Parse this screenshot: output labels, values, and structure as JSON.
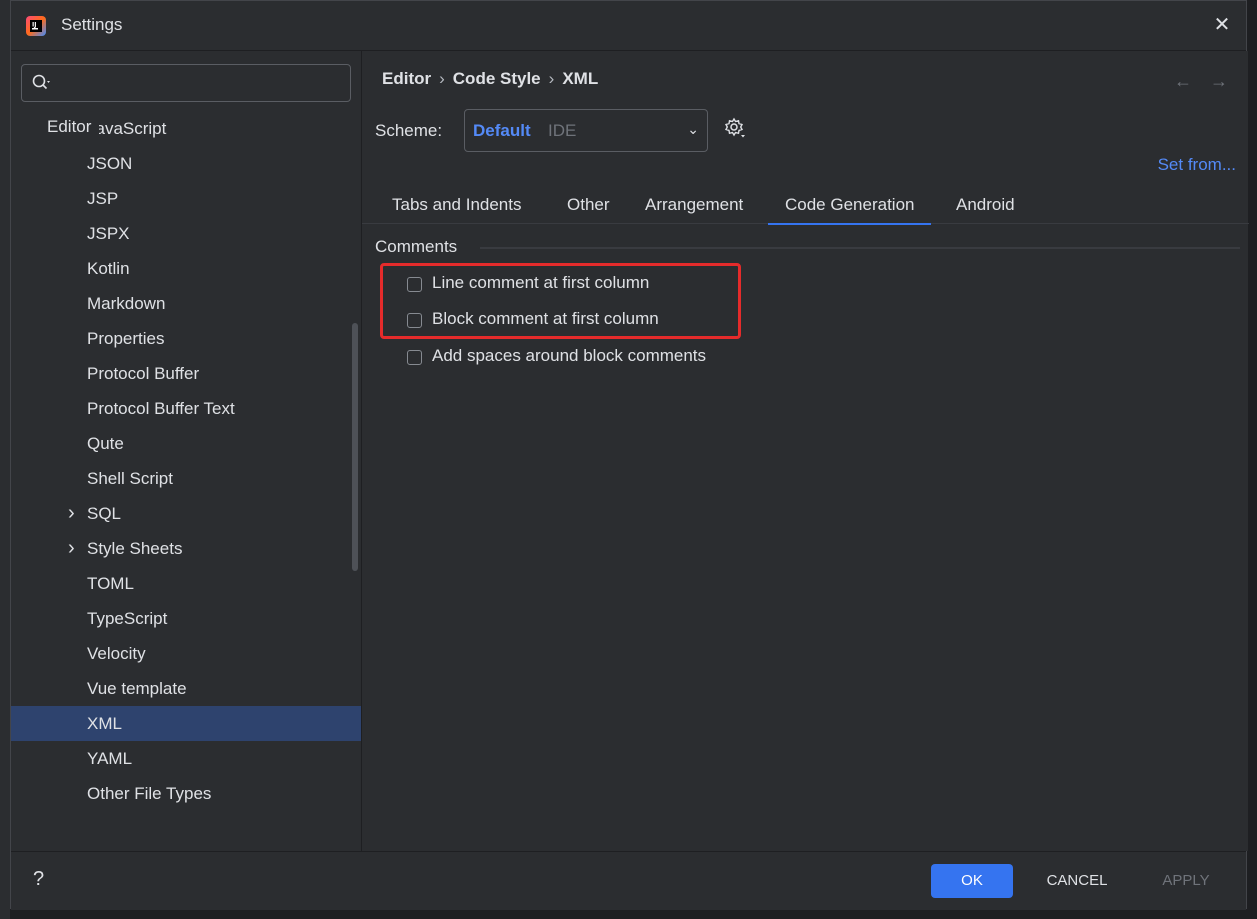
{
  "window": {
    "title": "Settings"
  },
  "sidebar": {
    "search": {
      "value": ""
    },
    "header": "Editor",
    "items": [
      {
        "label": "JavaScript",
        "expandable": false
      },
      {
        "label": "JSON",
        "expandable": false
      },
      {
        "label": "JSP",
        "expandable": false
      },
      {
        "label": "JSPX",
        "expandable": false
      },
      {
        "label": "Kotlin",
        "expandable": false
      },
      {
        "label": "Markdown",
        "expandable": false
      },
      {
        "label": "Properties",
        "expandable": false
      },
      {
        "label": "Protocol Buffer",
        "expandable": false
      },
      {
        "label": "Protocol Buffer Text",
        "expandable": false
      },
      {
        "label": "Qute",
        "expandable": false
      },
      {
        "label": "Shell Script",
        "expandable": false
      },
      {
        "label": "SQL",
        "expandable": true
      },
      {
        "label": "Style Sheets",
        "expandable": true
      },
      {
        "label": "TOML",
        "expandable": false
      },
      {
        "label": "TypeScript",
        "expandable": false
      },
      {
        "label": "Velocity",
        "expandable": false
      },
      {
        "label": "Vue template",
        "expandable": false
      },
      {
        "label": "XML",
        "expandable": false,
        "selected": true
      },
      {
        "label": "YAML",
        "expandable": false
      },
      {
        "label": "Other File Types",
        "expandable": false
      }
    ]
  },
  "breadcrumb": [
    "Editor",
    "Code Style",
    "XML"
  ],
  "scheme": {
    "label": "Scheme:",
    "value": "Default",
    "scope": "IDE"
  },
  "set_from": "Set from...",
  "tabs": [
    {
      "label": "Tabs and Indents"
    },
    {
      "label": "Other"
    },
    {
      "label": "Arrangement"
    },
    {
      "label": "Code Generation",
      "active": true
    },
    {
      "label": "Android"
    }
  ],
  "comments": {
    "title": "Comments",
    "options": [
      {
        "label": "Line comment at first column",
        "checked": false
      },
      {
        "label": "Block comment at first column",
        "checked": false
      },
      {
        "label": "Add spaces around block comments",
        "checked": false
      }
    ]
  },
  "footer": {
    "help": "?",
    "ok": "OK",
    "cancel": "CANCEL",
    "apply": "APPLY"
  },
  "colors": {
    "accent": "#3574f0",
    "link": "#548af7",
    "highlight_box": "#e52b2b",
    "selected_row": "#2e436e"
  }
}
